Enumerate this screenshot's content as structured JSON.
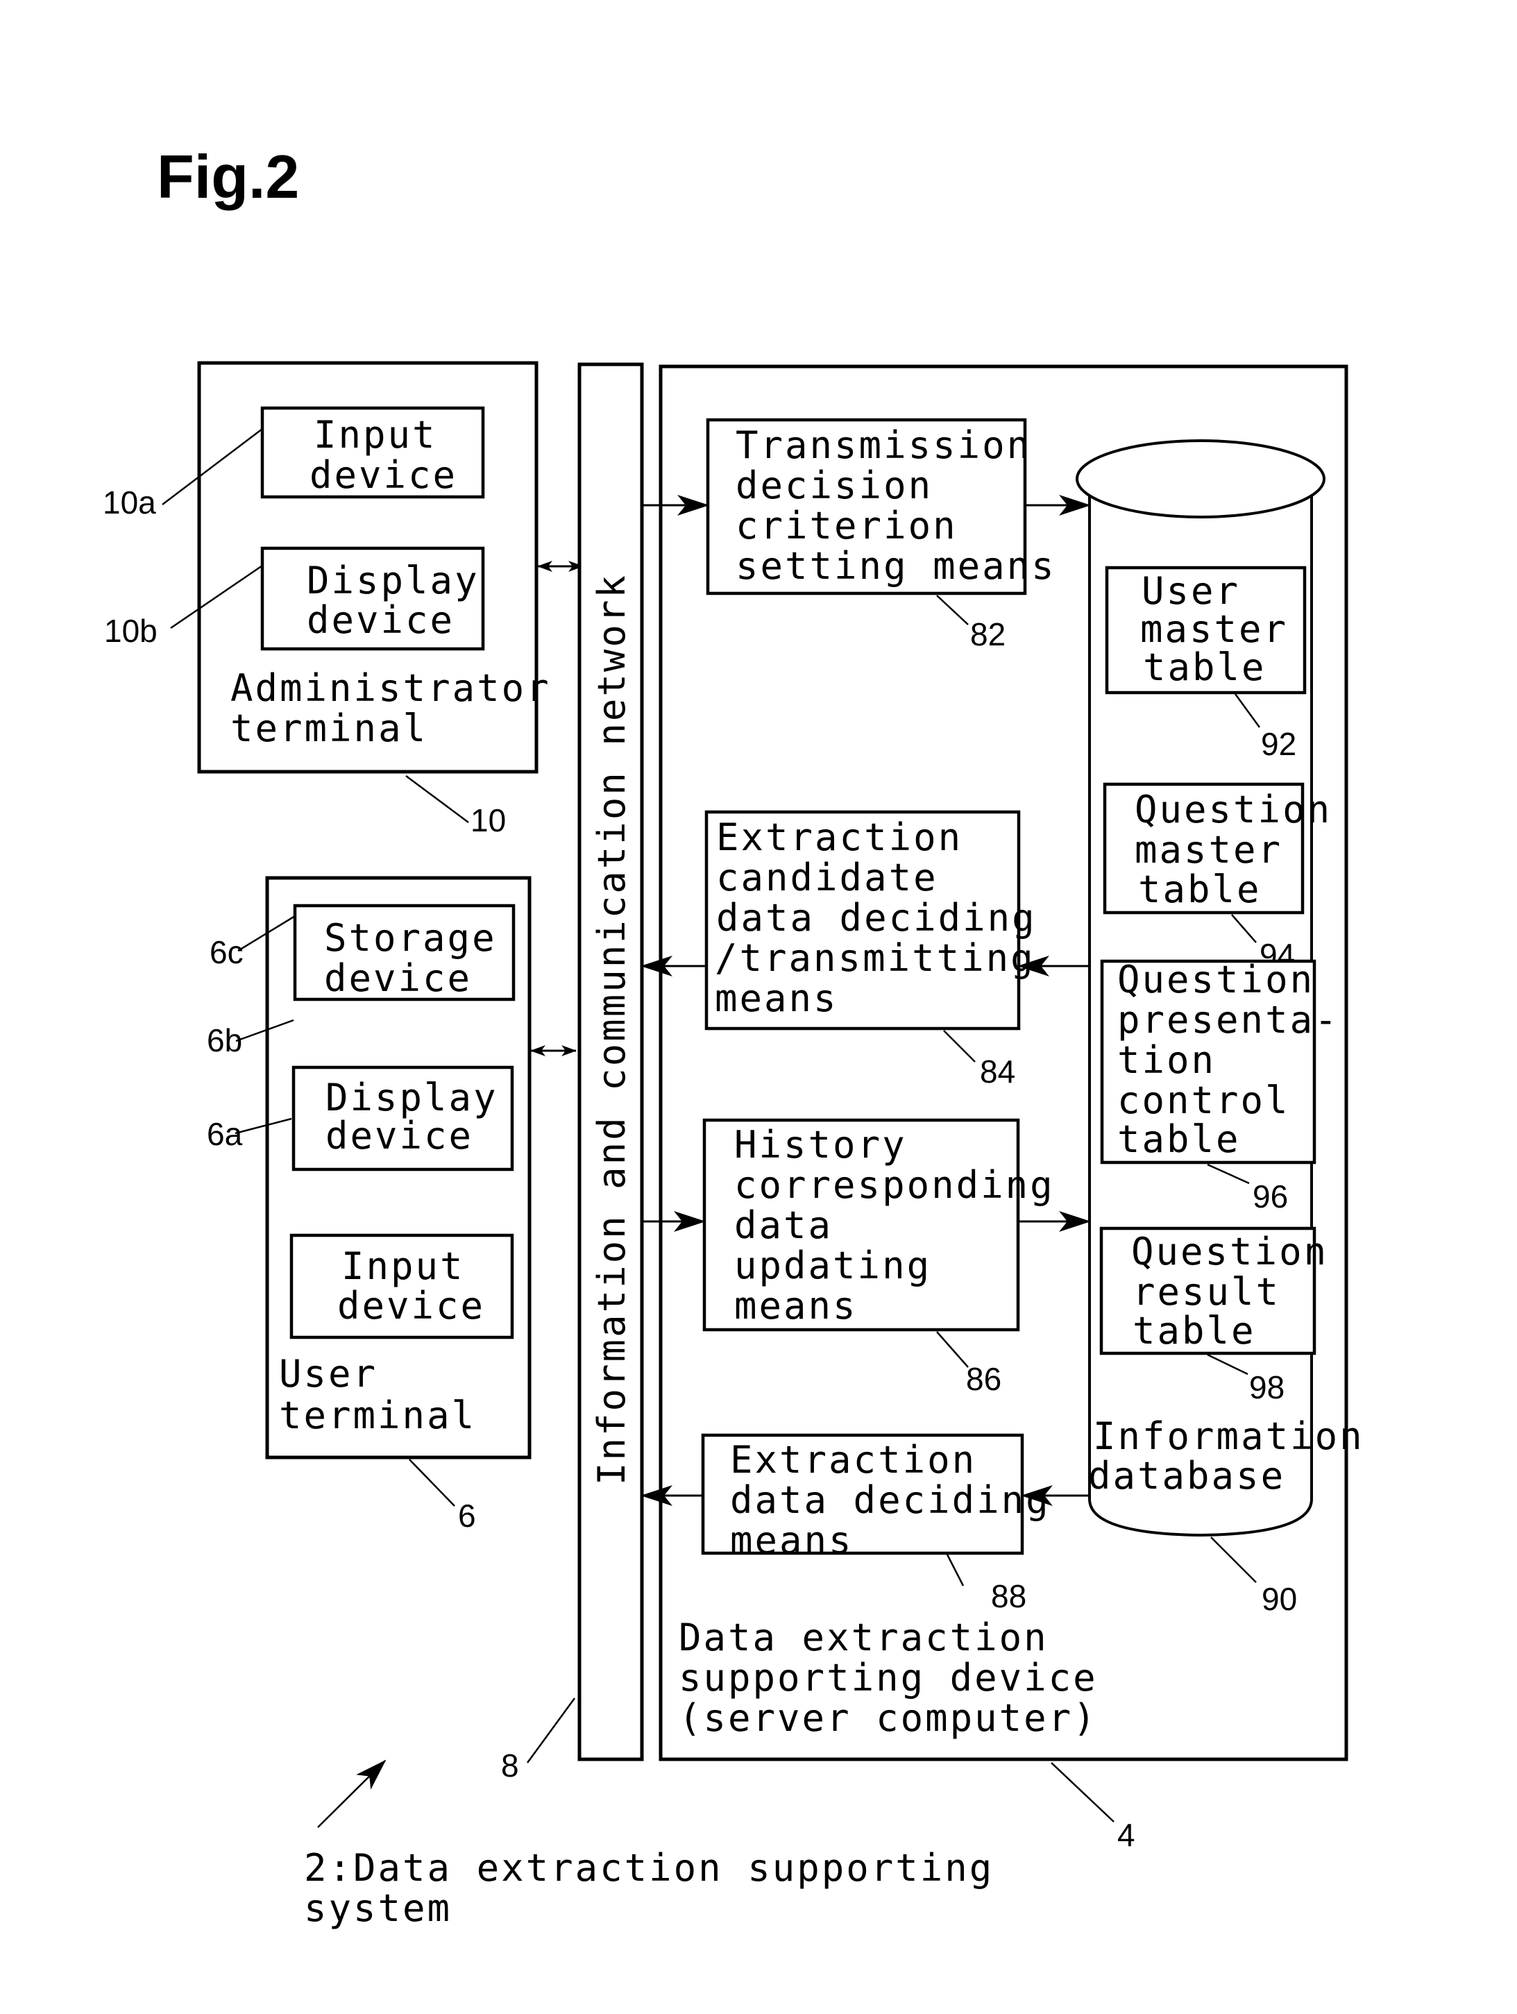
{
  "figure": {
    "title": "Fig.2",
    "system_caption": [
      "2:Data extraction supporting",
      "system"
    ]
  },
  "network": {
    "label": "Information and communication network",
    "ref": "8"
  },
  "administrator_terminal": {
    "label": [
      "Administrator",
      "terminal"
    ],
    "ref": "10",
    "components": [
      {
        "label": [
          "Input",
          "device"
        ],
        "ref": "10a"
      },
      {
        "label": [
          "Display",
          "device"
        ],
        "ref": "10b"
      }
    ]
  },
  "user_terminal": {
    "label": [
      "User",
      "terminal"
    ],
    "ref": "6",
    "components": [
      {
        "label": [
          "Storage",
          "device"
        ],
        "ref": "6c"
      },
      {
        "label": [
          "Display",
          "device"
        ],
        "ref": "6b"
      },
      {
        "label": [
          "Input",
          "device"
        ],
        "ref": "6a"
      }
    ]
  },
  "server": {
    "label": [
      "Data extraction",
      "supporting device",
      "(server computer)"
    ],
    "ref": "4",
    "means": [
      {
        "label": [
          "Transmission",
          "decision",
          "criterion",
          "setting means"
        ],
        "ref": "82"
      },
      {
        "label": [
          "Extraction",
          "candidate",
          "data deciding",
          "/transmitting",
          "means"
        ],
        "ref": "84"
      },
      {
        "label": [
          "History",
          "corresponding",
          "data",
          "updating",
          "means"
        ],
        "ref": "86"
      },
      {
        "label": [
          "Extraction",
          "data deciding",
          "means"
        ],
        "ref": "88"
      }
    ],
    "database": {
      "label": [
        "Information",
        "database"
      ],
      "ref": "90",
      "tables": [
        {
          "label": [
            "User",
            "master",
            "table"
          ],
          "ref": "92"
        },
        {
          "label": [
            "Question",
            "master",
            "table"
          ],
          "ref": "94"
        },
        {
          "label": [
            "Question",
            "presenta-",
            "tion",
            "control",
            "table"
          ],
          "ref": "96"
        },
        {
          "label": [
            "Question",
            "result",
            "table"
          ],
          "ref": "98"
        }
      ]
    }
  }
}
